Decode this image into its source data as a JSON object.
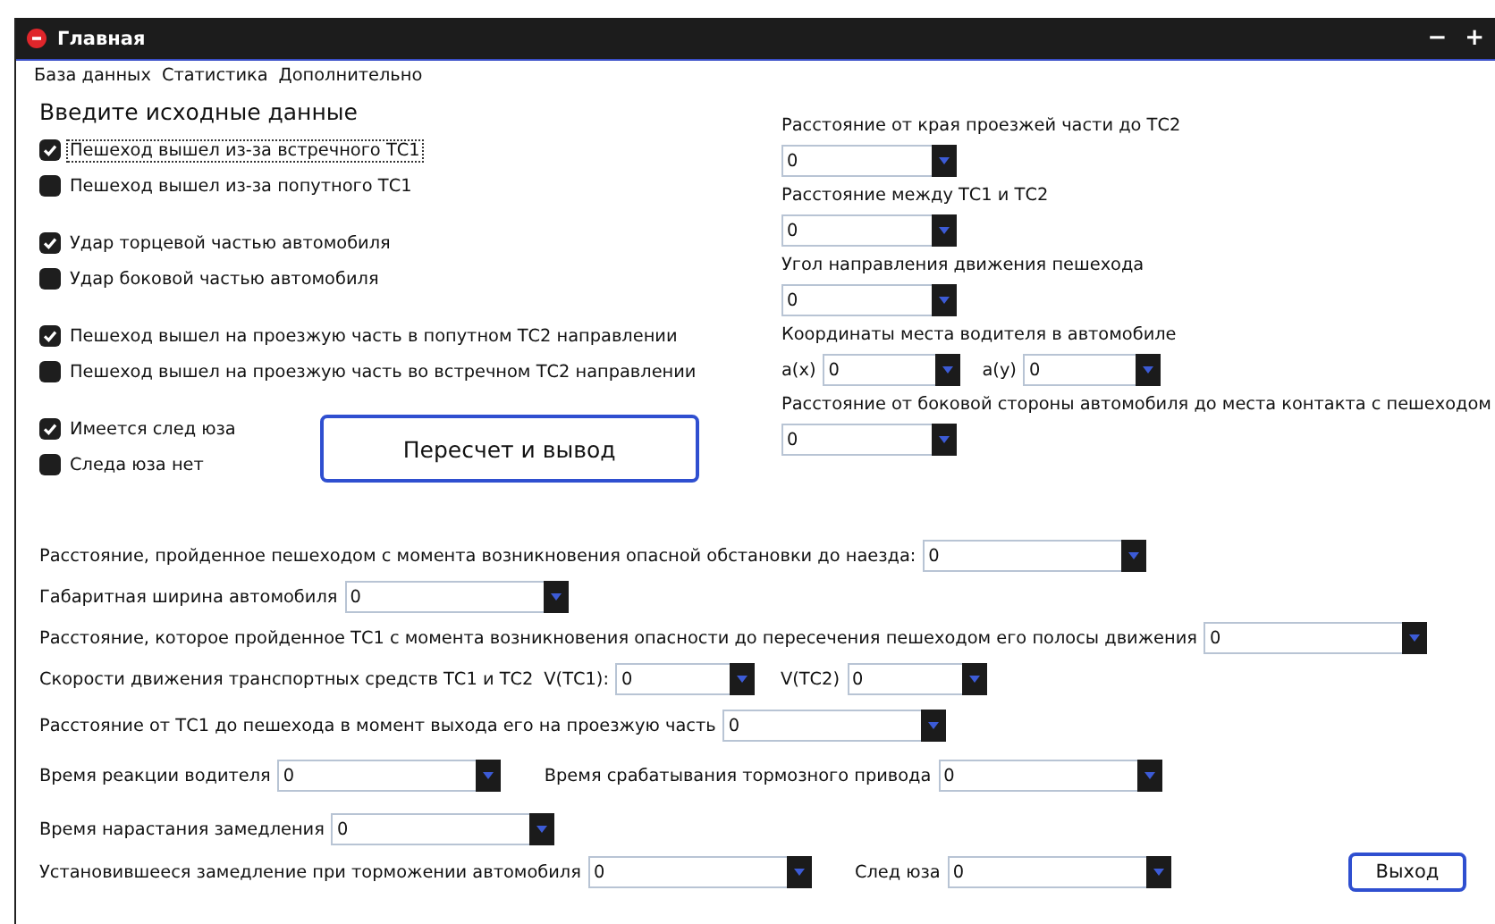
{
  "window": {
    "title": "Главная",
    "controls": [
      "−",
      "+"
    ]
  },
  "menu": [
    "База данных",
    "Статистика",
    "Дополнительно"
  ],
  "heading": "Введите исходные данные",
  "checkbox_groups": [
    [
      {
        "label": "Пешеход вышел из-за встречного ТС1",
        "checked": true,
        "focused": true
      },
      {
        "label": "Пешеход вышел из-за попутного ТС1",
        "checked": false,
        "focused": false
      }
    ],
    [
      {
        "label": "Удар торцевой частью автомобиля",
        "checked": true,
        "focused": false
      },
      {
        "label": "Удар боковой частью автомобиля",
        "checked": false,
        "focused": false
      }
    ],
    [
      {
        "label": "Пешеход вышел на проезжую часть в попутном ТС2 направлении",
        "checked": true,
        "focused": false
      },
      {
        "label": "Пешеход вышел на проезжую часть во встречном ТС2 направлении",
        "checked": false,
        "focused": false
      }
    ],
    [
      {
        "label": "Имеется след юза",
        "checked": true,
        "focused": false
      },
      {
        "label": "Следа юза нет",
        "checked": false,
        "focused": false
      }
    ]
  ],
  "recalc_button": "Пересчет и вывод",
  "right_fields": [
    {
      "label": "Расстояние от края проезжей части до ТС2",
      "value": "0"
    },
    {
      "label": "Расстояние между ТС1 и ТС2",
      "value": "0"
    },
    {
      "label": "Угол направления движения пешехода",
      "value": "0"
    },
    {
      "label": "Координаты места водителя в автомобиле",
      "fields": [
        {
          "label": "a(x)",
          "value": "0"
        },
        {
          "label": "a(y)",
          "value": "0"
        }
      ]
    },
    {
      "label": "Расстояние от боковой стороны автомобиля до места контакта с пешеходом",
      "value": "0"
    }
  ],
  "rows": [
    [
      {
        "label": "Расстояние, пройденное пешеходом с момента возникновения опасной обстановки до наезда:",
        "value": "0"
      }
    ],
    [
      {
        "label": "Габаритная ширина автомобиля",
        "value": "0"
      }
    ],
    [
      {
        "label": "Расстояние, которое пройденное ТС1 с момента возникновения опасности до пересечения пешеходом его полосы движения",
        "value": "0"
      }
    ],
    [
      {
        "label": "Скорости движения транспортных средств ТС1 и ТС2",
        "fields": [
          {
            "label": "V(ТС1):",
            "value": "0"
          },
          {
            "label": "V(ТС2)",
            "value": "0"
          }
        ]
      }
    ],
    [
      {
        "label": "Расстояние от ТС1 до пешехода в момент выхода его на проезжую часть",
        "value": "0"
      }
    ],
    [
      {
        "label": "Время реакции водителя",
        "value": "0"
      },
      {
        "label": "Время срабатывания тормозного привода",
        "value": "0"
      }
    ],
    [
      {
        "label": "Время нарастания замедления",
        "value": "0"
      }
    ],
    [
      {
        "label": "Установившееся замедление при торможении автомобиля",
        "value": "0"
      },
      {
        "label": "След юза",
        "value": "0"
      }
    ]
  ],
  "exit_button": "Выход"
}
